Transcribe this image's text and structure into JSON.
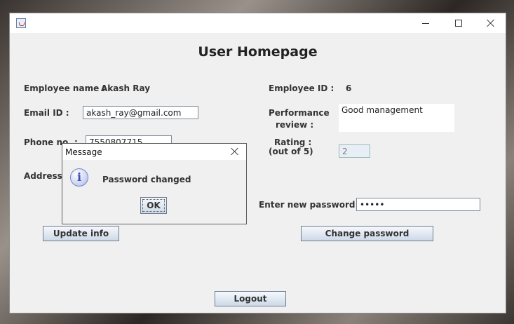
{
  "window": {
    "title": ""
  },
  "page": {
    "heading": "User Homepage"
  },
  "left": {
    "employee_name_label": "Employee name :",
    "employee_name_value": "Akash Ray",
    "email_label": "Email ID :",
    "email_value": "akash_ray@gmail.com",
    "phone_label": "Phone no. :",
    "phone_value": "7550807715",
    "address_label": "Address :",
    "update_button": "Update info"
  },
  "right": {
    "employee_id_label": "Employee ID :",
    "employee_id_value": "6",
    "review_label_line1": "Performance",
    "review_label_line2": "review :",
    "review_value": "Good management",
    "rating_label_line1": "Rating :",
    "rating_label_line2": "(out of 5)",
    "rating_value": "2",
    "new_password_label": "Enter new password :",
    "new_password_value": "•••••",
    "change_password_button": "Change password"
  },
  "footer": {
    "logout_button": "Logout"
  },
  "dialog": {
    "title": "Message",
    "message": "Password changed",
    "ok_button": "OK",
    "icon": "info-icon"
  },
  "icons": {
    "app": "java-cup-icon",
    "minimize": "minimize-icon",
    "maximize": "maximize-icon",
    "close": "close-icon"
  }
}
